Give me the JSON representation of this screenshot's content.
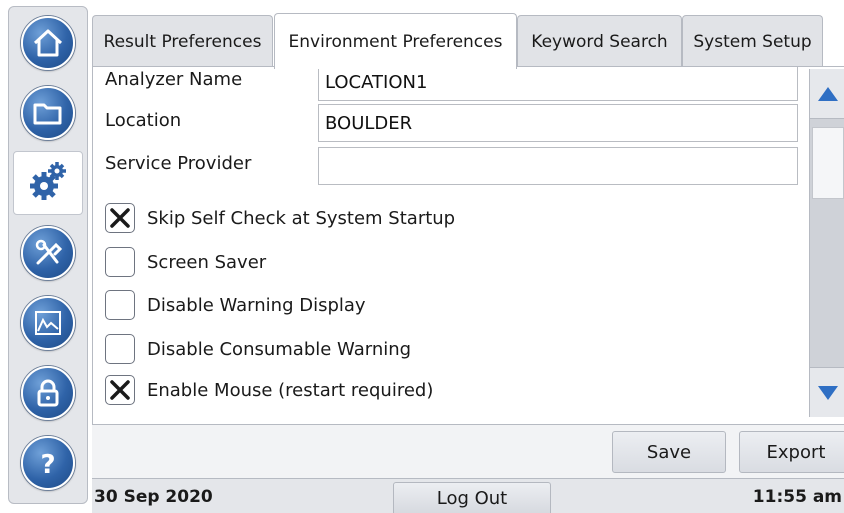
{
  "nav": {
    "icons": [
      "home-icon",
      "folder-icon",
      "gears-icon",
      "tools-icon",
      "chart-icon",
      "lock-icon",
      "help-icon"
    ],
    "active": "gears-icon"
  },
  "tabs": [
    {
      "label": "Result Preferences",
      "active": false
    },
    {
      "label": "Environment Preferences",
      "active": true
    },
    {
      "label": "Keyword Search",
      "active": false
    },
    {
      "label": "System Setup",
      "active": false
    }
  ],
  "fields": {
    "analyzer_name": {
      "label": "Analyzer Name",
      "value": "LOCATION1"
    },
    "location": {
      "label": "Location",
      "value": "BOULDER"
    },
    "service_provider": {
      "label": "Service Provider",
      "value": ""
    }
  },
  "options": [
    {
      "label": "Skip Self Check at System Startup",
      "checked": true
    },
    {
      "label": "Screen Saver",
      "checked": false
    },
    {
      "label": "Disable Warning Display",
      "checked": false
    },
    {
      "label": "Disable Consumable Warning",
      "checked": false
    },
    {
      "label": "Enable Mouse (restart required)",
      "checked": true
    }
  ],
  "actions": {
    "save": "Save",
    "export": "Export"
  },
  "status": {
    "date": "30 Sep 2020",
    "logout": "Log Out",
    "time": "11:55 am"
  },
  "colors": {
    "accent": "#2f63a8",
    "scroll_arrow": "#2f6fc4"
  }
}
